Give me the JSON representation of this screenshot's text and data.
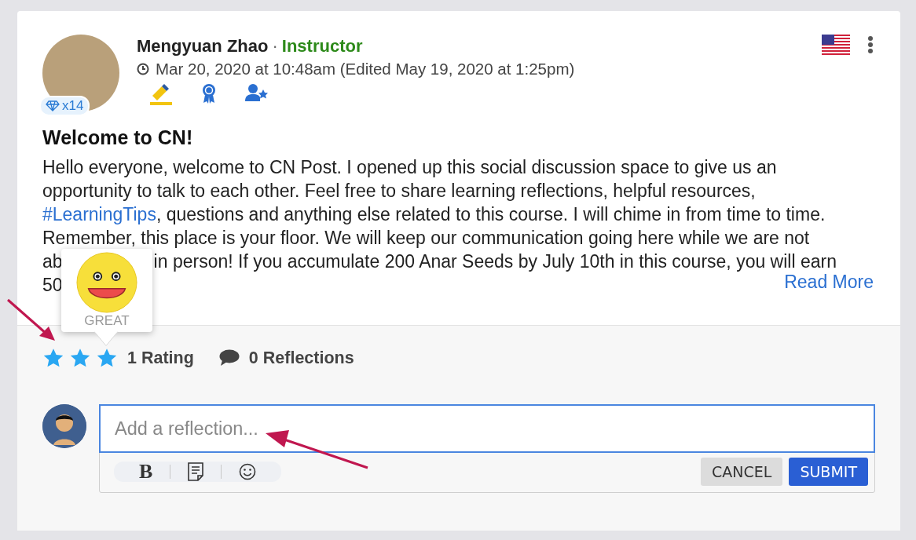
{
  "post": {
    "author": "Mengyuan Zhao",
    "separator": "·",
    "role": "Instructor",
    "timestamp": "Mar 20, 2020 at 10:48am (Edited May 19, 2020 at 1:25pm)",
    "gem_count": "x14",
    "title": "Welcome to CN!",
    "body_lines": [
      {
        "segments": [
          {
            "text": "Hello everyone, welcome to CN Post. I opened up this social discussion space to give us an",
            "kind": "text"
          }
        ]
      },
      {
        "segments": [
          {
            "text": "opportunity to talk to each other. Feel free to share learning reflections, helpful resources,",
            "kind": "text"
          }
        ]
      },
      {
        "segments": [
          {
            "text": "#LearningTips",
            "kind": "hashtag"
          },
          {
            "text": ", questions and anything else related to this course. I will chime in from time to time.",
            "kind": "text"
          }
        ]
      },
      {
        "segments": [
          {
            "text": "Remember, this place is your floor. We will keep our communication going here while we are not",
            "kind": "text"
          }
        ]
      },
      {
        "segments": [
          {
            "text": "ab",
            "kind": "text"
          },
          {
            "text": "in person! If you accumulate 200 Anar Seeds by July 10th in this course, you will earn",
            "kind": "covered-before"
          }
        ]
      },
      {
        "segments": [
          {
            "text": "50",
            "kind": "text"
          }
        ]
      }
    ],
    "read_more": "Read More"
  },
  "rating": {
    "stars": 3,
    "tooltip_label": "GREAT",
    "rating_count": "1 Rating",
    "reflections_count": "0 Reflections"
  },
  "composer": {
    "placeholder": "Add a reflection...",
    "toolbar": [
      {
        "kind": "bold",
        "label": "B"
      },
      {
        "kind": "note"
      },
      {
        "kind": "emoji"
      }
    ],
    "buttons": [
      {
        "label": "CANCEL",
        "kind": "secondary"
      },
      {
        "label": "SUBMIT",
        "kind": "primary"
      }
    ]
  }
}
